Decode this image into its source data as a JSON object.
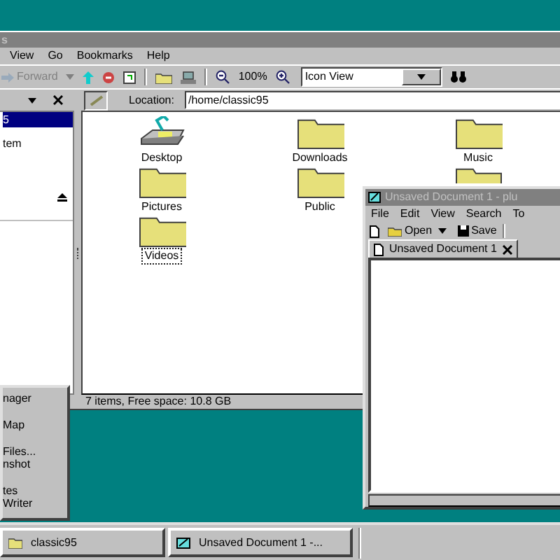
{
  "file_manager": {
    "title": "s",
    "menu": [
      {
        "label": "View"
      },
      {
        "label": "Go"
      },
      {
        "label": "Bookmarks"
      },
      {
        "label": "Help"
      }
    ],
    "toolbar": {
      "forward": "Forward",
      "zoom": "100%",
      "view_mode": "Icon View"
    },
    "location": {
      "label": "Location:",
      "value": "/home/classic95"
    },
    "sidebar": {
      "items": [
        {
          "kind": "place",
          "label": "5",
          "selected": true
        },
        {
          "kind": "place",
          "label": "tem",
          "selected": false
        },
        {
          "kind": "device",
          "selected": false
        }
      ]
    },
    "files": [
      {
        "kind": "desktop",
        "name": "Desktop",
        "selected": false
      },
      {
        "kind": "folder",
        "name": "Downloads",
        "selected": false
      },
      {
        "kind": "folder",
        "name": "Music",
        "selected": false
      },
      {
        "kind": "folder",
        "name": "Pictures",
        "selected": false
      },
      {
        "kind": "folder",
        "name": "Public",
        "selected": false
      },
      {
        "kind": "folder"
      },
      {
        "kind": "folder",
        "name": "Videos",
        "selected": true
      }
    ],
    "status": "7 items, Free space: 10.8 GB"
  },
  "start_menu": {
    "groups": [
      [
        "nager"
      ],
      [
        "Map"
      ],
      [
        "Files...",
        "nshot"
      ],
      [
        "tes",
        "Writer"
      ]
    ]
  },
  "editor": {
    "title": "Unsaved Document 1 - plu",
    "menu": [
      {
        "label": "File"
      },
      {
        "label": "Edit"
      },
      {
        "label": "View"
      },
      {
        "label": "Search"
      },
      {
        "label": "To"
      }
    ],
    "toolbar": {
      "open": "Open",
      "save": "Save"
    },
    "tabs": [
      {
        "label": "Unsaved Document 1",
        "selected": true
      }
    ]
  },
  "taskbar": {
    "buttons": [
      {
        "kind": "folder",
        "label": "classic95",
        "selected": false
      },
      {
        "kind": "editor",
        "label": "Unsaved Document 1 -...",
        "selected": false
      }
    ]
  }
}
